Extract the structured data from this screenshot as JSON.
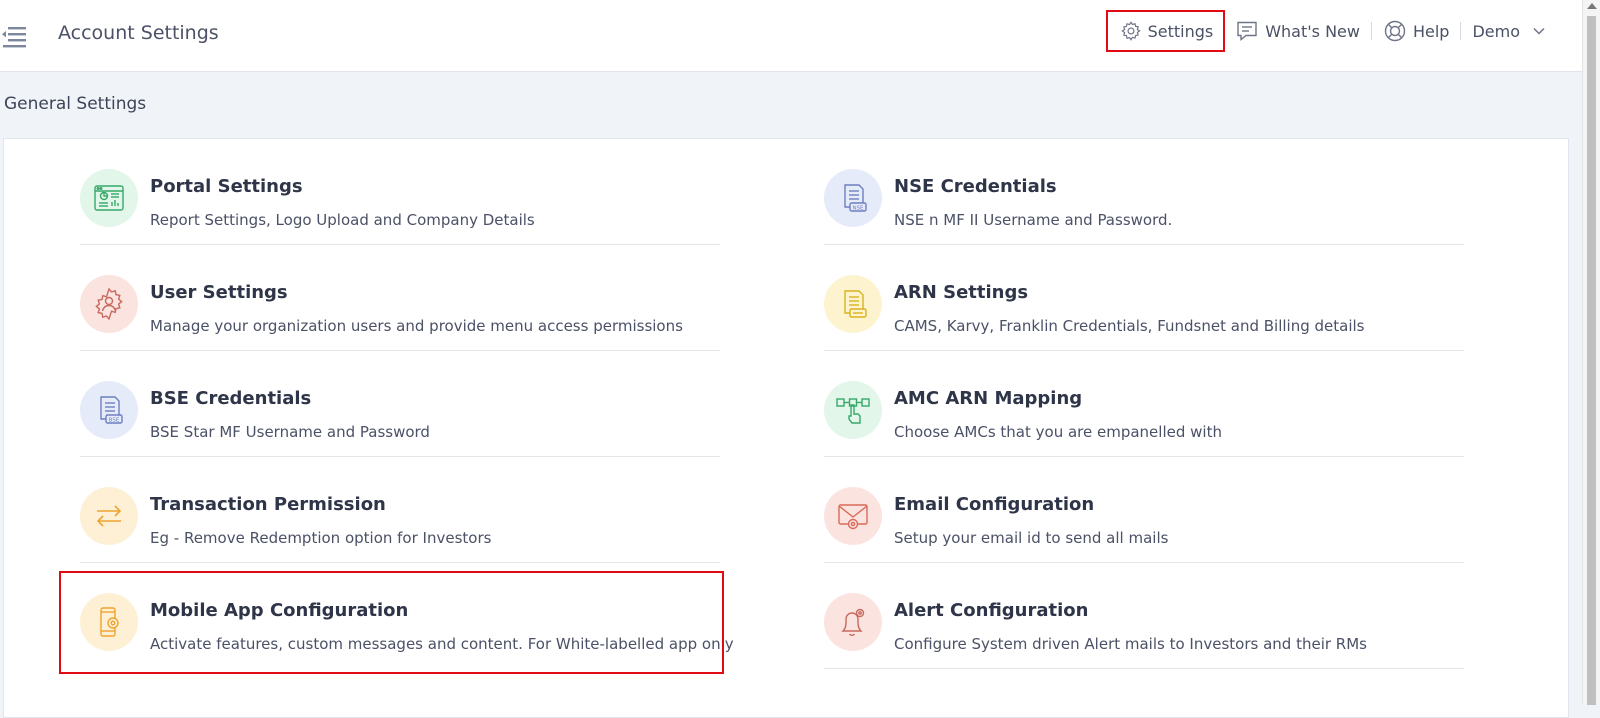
{
  "header": {
    "title": "Account Settings",
    "menu_icon": "menu-collapse-icon"
  },
  "topnav": {
    "settings": {
      "label": "Settings",
      "icon": "gear-icon"
    },
    "whats_new": {
      "label": "What's New",
      "icon": "chat-message-icon"
    },
    "help": {
      "label": "Help",
      "icon": "lifebuoy-icon"
    },
    "user": {
      "label": "Demo",
      "icon": "chevron-down-icon"
    }
  },
  "section": {
    "title": "General Settings"
  },
  "items": [
    {
      "title": "Portal Settings",
      "description": "Report Settings, Logo Upload and Company Details",
      "icon": "browser-dashboard-icon",
      "icon_color": "#37a86a",
      "bg_color": "#e3f6ea"
    },
    {
      "title": "NSE Credentials",
      "description": "NSE n MF II Username and Password.",
      "icon": "nse-document-icon",
      "icon_color": "#6d7fc0",
      "bg_color": "#e6ebfa"
    },
    {
      "title": "User Settings",
      "description": "Manage your organization users and provide menu access permissions",
      "icon": "user-gear-icon",
      "icon_color": "#c76a5e",
      "bg_color": "#fbe3df"
    },
    {
      "title": "ARN Settings",
      "description": "CAMS, Karvy, Franklin Credentials, Fundsnet and Billing details",
      "icon": "arn-document-icon",
      "icon_color": "#d9b21e",
      "bg_color": "#fdf4cf"
    },
    {
      "title": "BSE Credentials",
      "description": "BSE Star MF Username and Password",
      "icon": "bse-document-icon",
      "icon_color": "#6d7fc0",
      "bg_color": "#e6ebfa"
    },
    {
      "title": "AMC ARN Mapping",
      "description": "Choose AMCs that you are empanelled with",
      "icon": "mapping-hand-icon",
      "icon_color": "#37a86a",
      "bg_color": "#e3f6ea"
    },
    {
      "title": "Transaction Permission",
      "description": "Eg - Remove Redemption option for Investors",
      "icon": "swap-arrows-icon",
      "icon_color": "#f0a22e",
      "bg_color": "#fdf0d5"
    },
    {
      "title": "Email Configuration",
      "description": "Setup your email id to send all mails",
      "icon": "email-gear-icon",
      "icon_color": "#d96b5a",
      "bg_color": "#fbe3df"
    },
    {
      "title": "Mobile App Configuration",
      "description": "Activate features, custom messages and content. For White-labelled app only",
      "icon": "mobile-gear-icon",
      "icon_color": "#f0a22e",
      "bg_color": "#fdf0d5"
    },
    {
      "title": "Alert Configuration",
      "description": "Configure System driven Alert mails to Investors and their RMs",
      "icon": "bell-gear-icon",
      "icon_color": "#c76a5e",
      "bg_color": "#fbe3df"
    }
  ],
  "colors": {
    "highlight": "#e20b14",
    "background": "#f0f3f7"
  }
}
